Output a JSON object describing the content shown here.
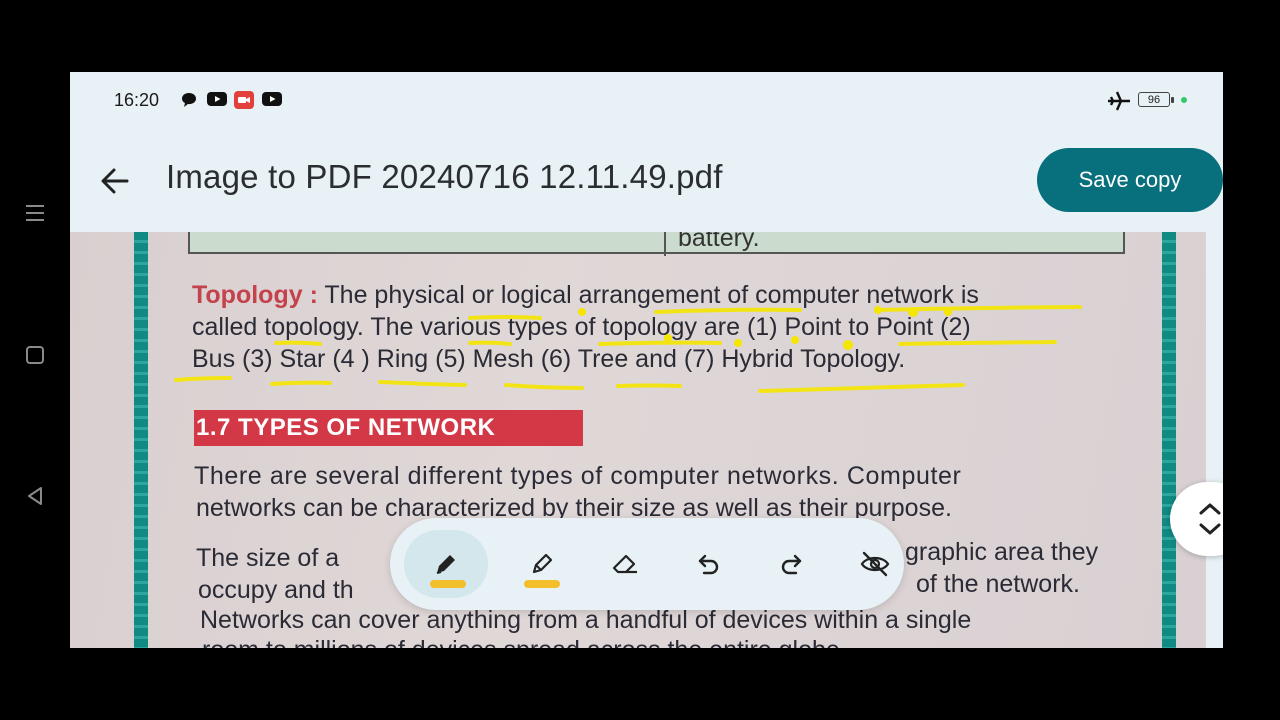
{
  "status_bar": {
    "time": "16:20",
    "notifications": [
      "chat-icon",
      "youtube-icon",
      "screen-record-icon",
      "youtube-icon"
    ],
    "battery": "96",
    "icons": [
      "airplane-mode-icon",
      "battery-icon"
    ]
  },
  "app_bar": {
    "title": "Image to PDF 20240716 12.11.49.pdf",
    "save_label": "Save copy",
    "accent": "#086f7c"
  },
  "document": {
    "table_fragment": "battery.",
    "topology_label": "Topology :",
    "topology_lines": [
      " The physical or logical arrangement of computer network is",
      "called topology. The various types of topology are (1) Point to Point (2)",
      "Bus (3) Star (4 ) Ring (5) Mesh (6) Tree and (7) Hybrid Topology."
    ],
    "section_heading": "1.7 TYPES OF NETWORK",
    "para1_lines": [
      "There are several different types of computer networks. Computer",
      "networks can be characterized by their size as well as their purpose."
    ],
    "para2_lines": [
      "The size of a",
      "graphic area they",
      "occupy and th",
      "of the network.",
      "Networks can cover anything from a handful of devices within a single",
      "room to millions of devices spread across the entire globe."
    ],
    "highlight_color": "#f5e600"
  },
  "annotation_toolbar": {
    "tools": [
      "pen-icon",
      "highlighter-icon",
      "eraser-icon",
      "undo-icon",
      "redo-icon",
      "hide-annotations-icon"
    ],
    "swatch_color": "#f3c02c"
  },
  "system_nav": [
    "menu-icon",
    "home-icon",
    "back-nav-icon"
  ]
}
